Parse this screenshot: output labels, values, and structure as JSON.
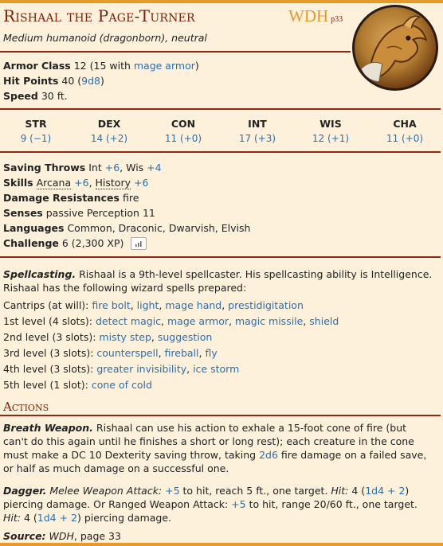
{
  "header": {
    "name": "Rishaal the Page-Turner",
    "source_abbr": "WDH",
    "source_page": "p33",
    "type_line": "Medium humanoid (dragonborn), neutral"
  },
  "basics": {
    "ac_label": "Armor Class",
    "ac_value": "12 (15 with ",
    "ac_link": "mage armor",
    "ac_close": ")",
    "hp_label": "Hit Points",
    "hp_value": "40 (",
    "hp_dice": "9d8",
    "hp_close": ")",
    "speed_label": "Speed",
    "speed_value": "30 ft."
  },
  "abilities": [
    {
      "label": "STR",
      "value": "9 (−1)"
    },
    {
      "label": "DEX",
      "value": "14 (+2)"
    },
    {
      "label": "CON",
      "value": "11 (+0)"
    },
    {
      "label": "INT",
      "value": "17 (+3)"
    },
    {
      "label": "WIS",
      "value": "12 (+1)"
    },
    {
      "label": "CHA",
      "value": "11 (+0)"
    }
  ],
  "details": {
    "saves_label": "Saving Throws",
    "saves_int": "Int ",
    "saves_int_bonus": "+6",
    "saves_wis": ", Wis ",
    "saves_wis_bonus": "+4",
    "skills_label": "Skills",
    "skill_arcana": "Arcana",
    "skill_arcana_bonus": "+6",
    "skill_sep": ", ",
    "skill_history": "History",
    "skill_history_bonus": "+6",
    "resist_label": "Damage Resistances",
    "resist_value": "fire",
    "senses_label": "Senses",
    "senses_value": "passive Perception 11",
    "languages_label": "Languages",
    "languages_value": "Common, Draconic, Dwarvish, Elvish",
    "challenge_label": "Challenge",
    "challenge_value": "6 (2,300 XP)"
  },
  "spellcasting": {
    "title": "Spellcasting.",
    "intro": "Rishaal is a 9th-level spellcaster. His spellcasting ability is Intelligence. Rishaal has the following wizard spells prepared:",
    "levels": [
      {
        "label": "Cantrips (at will): ",
        "spells": [
          "fire bolt",
          "light",
          "mage hand",
          "prestidigitation"
        ]
      },
      {
        "label": "1st level (4 slots): ",
        "spells": [
          "detect magic",
          "mage armor",
          "magic missile",
          "shield"
        ]
      },
      {
        "label": "2nd level (3 slots): ",
        "spells": [
          "misty step",
          "suggestion"
        ]
      },
      {
        "label": "3rd level (3 slots): ",
        "spells": [
          "counterspell",
          "fireball",
          "fly"
        ]
      },
      {
        "label": "4th level (3 slots): ",
        "spells": [
          "greater invisibility",
          "ice storm"
        ]
      },
      {
        "label": "5th level (1 slot): ",
        "spells": [
          "cone of cold"
        ]
      }
    ]
  },
  "actions": {
    "heading": "Actions",
    "breath_title": "Breath Weapon.",
    "breath_text_1": "Rishaal can use his action to exhale a 15-foot cone of fire (but can't do this again until he finishes a short or long rest); each creature in the cone must make a DC 10 Dexterity saving throw, taking ",
    "breath_dice": "2d6",
    "breath_text_2": " fire damage on a failed save, or half as much damage on a successful one.",
    "dagger_title": "Dagger.",
    "dagger_melee": "Melee Weapon Attack:",
    "dagger_bonus1": "+5",
    "dagger_t1": " to hit, reach 5 ft., one target. ",
    "hit_label": "Hit:",
    "dagger_t2": " 4 (",
    "dagger_dice1": "1d4 + 2",
    "dagger_t3": ") piercing damage. Or Ranged Weapon Attack: ",
    "dagger_bonus2": "+5",
    "dagger_t4": " to hit, range 20/60 ft., one target. ",
    "dagger_t5": " 4 (",
    "dagger_dice2": "1d4 + 2",
    "dagger_t6": ") piercing damage."
  },
  "source": {
    "label": "Source:",
    "book": "WDH",
    "page": ", page 33"
  }
}
